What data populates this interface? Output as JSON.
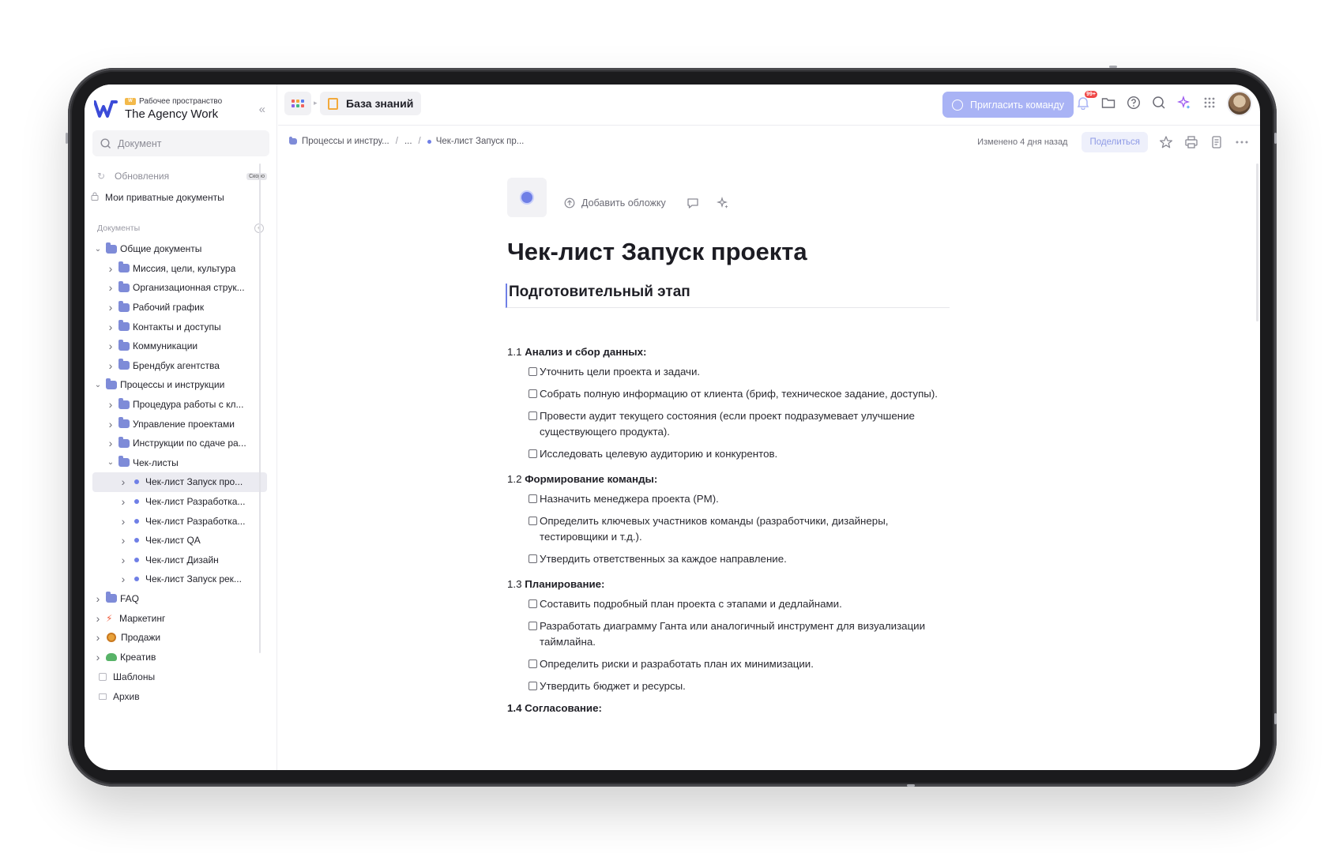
{
  "workspace": {
    "label": "Рабочее пространство",
    "name": "The Agency Work"
  },
  "sidebar": {
    "search_placeholder": "Документ",
    "updates_label": "Обновления",
    "updates_badge": "Скоро",
    "private_label": "Мои приватные документы",
    "section_label": "Документы",
    "tree": [
      {
        "label": "Общие документы",
        "level": 0,
        "expanded": true,
        "icon": "folder"
      },
      {
        "label": "Миссия, цели, культура",
        "level": 1,
        "expanded": false,
        "icon": "folder"
      },
      {
        "label": "Организационная струк...",
        "level": 1,
        "expanded": false,
        "icon": "folder"
      },
      {
        "label": "Рабочий график",
        "level": 1,
        "expanded": false,
        "icon": "folder"
      },
      {
        "label": "Контакты и доступы",
        "level": 1,
        "expanded": false,
        "icon": "folder"
      },
      {
        "label": "Коммуникации",
        "level": 1,
        "expanded": false,
        "icon": "folder"
      },
      {
        "label": "Брендбук агентства",
        "level": 1,
        "expanded": false,
        "icon": "folder"
      },
      {
        "label": "Процессы и инструкции",
        "level": 0,
        "expanded": true,
        "icon": "folder"
      },
      {
        "label": "Процедура работы с кл...",
        "level": 1,
        "expanded": false,
        "icon": "folder"
      },
      {
        "label": "Управление проектами",
        "level": 1,
        "expanded": false,
        "icon": "folder"
      },
      {
        "label": "Инструкции по сдаче ра...",
        "level": 1,
        "expanded": false,
        "icon": "folder"
      },
      {
        "label": "Чек-листы",
        "level": 1,
        "expanded": true,
        "icon": "folder"
      },
      {
        "label": "Чек-лист Запуск про...",
        "level": 2,
        "expanded": false,
        "icon": "dot",
        "active": true
      },
      {
        "label": "Чек-лист Разработка...",
        "level": 2,
        "expanded": false,
        "icon": "dot"
      },
      {
        "label": "Чек-лист Разработка...",
        "level": 2,
        "expanded": false,
        "icon": "dot"
      },
      {
        "label": "Чек-лист QA",
        "level": 2,
        "expanded": false,
        "icon": "dot"
      },
      {
        "label": "Чек-лист Дизайн",
        "level": 2,
        "expanded": false,
        "icon": "dot"
      },
      {
        "label": "Чек-лист Запуск рек...",
        "level": 2,
        "expanded": false,
        "icon": "dot"
      },
      {
        "label": "FAQ",
        "level": 0,
        "expanded": false,
        "icon": "folder"
      },
      {
        "label": "Маркетинг",
        "level": 0,
        "expanded": false,
        "icon": "lightning"
      },
      {
        "label": "Продажи",
        "level": 0,
        "expanded": false,
        "icon": "coin"
      },
      {
        "label": "Креатив",
        "level": 0,
        "expanded": false,
        "icon": "frog"
      }
    ],
    "templates_label": "Шаблоны",
    "archive_label": "Архив"
  },
  "topbar": {
    "tab_label": "База знаний",
    "invite_label": "Пригласить команду",
    "notifications_badge": "99+"
  },
  "breadcrumbs": {
    "parent": "Процессы и инстру...",
    "ellipsis": "...",
    "current": "Чек-лист Запуск пр...",
    "edited": "Изменено 4 дня назад",
    "share_label": "Поделиться"
  },
  "document": {
    "add_cover": "Добавить обложку",
    "title": "Чек-лист Запуск проекта",
    "heading": "Подготовительный этап",
    "sections": [
      {
        "num": "1.1",
        "title": "Анализ и сбор данных:",
        "items": [
          "Уточнить цели проекта и задачи.",
          "Собрать полную информацию от клиента (бриф, техническое задание, доступы).",
          "Провести аудит текущего состояния (если проект подразумевает улучшение существующего продукта).",
          "Исследовать целевую аудиторию и конкурентов."
        ]
      },
      {
        "num": "1.2",
        "title": "Формирование команды:",
        "items": [
          "Назначить менеджера проекта (PM).",
          "Определить ключевых участников команды (разработчики, дизайнеры, тестировщики и т.д.).",
          "Утвердить ответственных за каждое направление."
        ]
      },
      {
        "num": "1.3",
        "title": "Планирование:",
        "items": [
          "Составить подробный план проекта с этапами и дедлайнами.",
          "Разработать диаграмму Ганта или аналогичный инструмент для визуализации таймлайна.",
          "Определить риски и разработать план их минимизации.",
          "Утвердить бюджет и ресурсы."
        ]
      }
    ],
    "next_section_partial": "1.4 Согласование:"
  },
  "colors": {
    "accent": "#6f7fe6",
    "invite_bg": "#a9b3f5",
    "tab_icon": "#f2a93b",
    "badge": "#ef4747"
  }
}
